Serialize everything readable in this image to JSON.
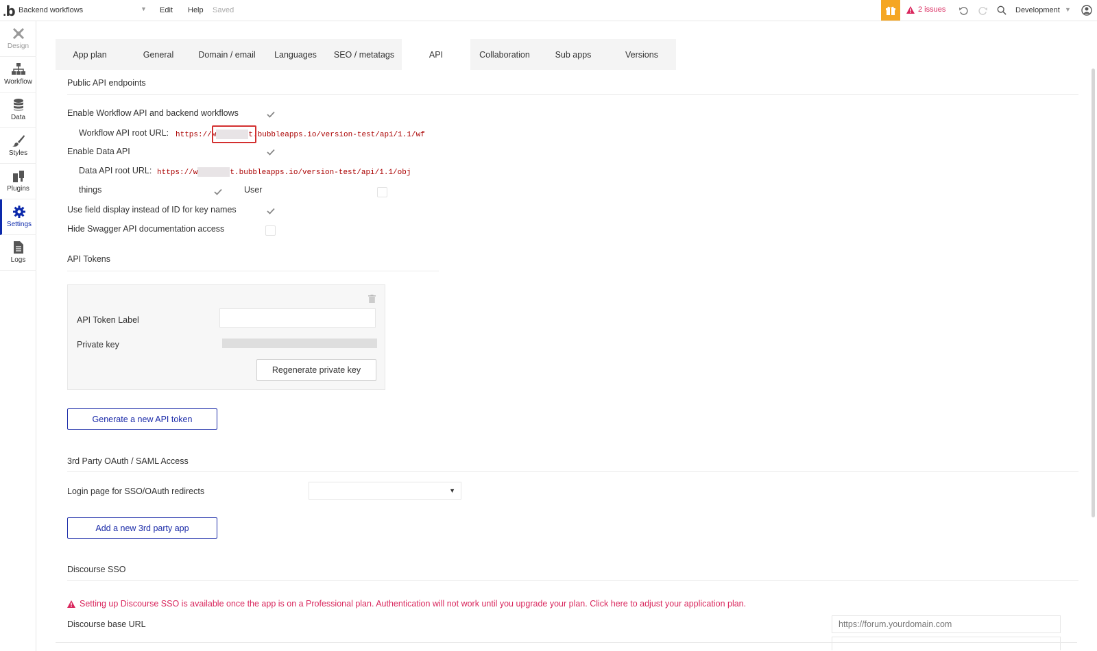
{
  "topbar": {
    "logo": "b",
    "page_name": "Backend workflows",
    "menu_edit": "Edit",
    "menu_help": "Help",
    "status": "Saved",
    "issues": "2 issues",
    "environment": "Development",
    "accent_color": "#f5a623",
    "issue_color": "#d9265c"
  },
  "sidebar": {
    "items": [
      {
        "label": "Design",
        "icon": "design-icon"
      },
      {
        "label": "Workflow",
        "icon": "workflow-icon"
      },
      {
        "label": "Data",
        "icon": "database-icon"
      },
      {
        "label": "Styles",
        "icon": "brush-icon"
      },
      {
        "label": "Plugins",
        "icon": "plug-icon"
      },
      {
        "label": "Settings",
        "icon": "gear-icon"
      },
      {
        "label": "Logs",
        "icon": "document-icon"
      }
    ],
    "active": "Settings",
    "active_color": "#0c29ab"
  },
  "tabs": [
    "App plan",
    "General",
    "Domain / email",
    "Languages",
    "SEO / metatags",
    "API",
    "Collaboration",
    "Sub apps",
    "Versions"
  ],
  "active_tab": "API",
  "public_api": {
    "title": "Public API endpoints",
    "enable_workflow_label": "Enable Workflow API and backend workflows",
    "workflow_root_label": "Workflow API root URL:",
    "workflow_url_prefix": "https://w",
    "workflow_url_suffix": "t.bubbleapps.io/version-test/api/1.1/wf",
    "enable_data_label": "Enable Data API",
    "data_root_label": "Data API root URL:",
    "data_url_prefix": "https://w",
    "data_url_suffix": "t.bubbleapps.io/version-test/api/1.1/obj",
    "type_things": "things",
    "type_user": "User",
    "field_display_label": "Use field display instead of ID for key names",
    "hide_swagger_label": "Hide Swagger API documentation access"
  },
  "tokens": {
    "title": "API Tokens",
    "label_field": "API Token Label",
    "private_key_label": "Private key",
    "regenerate": "Regenerate private key",
    "generate": "Generate a new API token"
  },
  "oauth": {
    "title": "3rd Party OAuth / SAML Access",
    "login_page_label": "Login page for SSO/OAuth redirects",
    "add_app": "Add a new 3rd party app"
  },
  "discourse": {
    "title": "Discourse SSO",
    "warning": "Setting up Discourse SSO is available once the app is on a Professional plan. Authentication will not work until you upgrade your plan. Click here to adjust your application plan.",
    "base_url_label": "Discourse base URL",
    "base_url_placeholder": "https://forum.yourdomain.com"
  }
}
